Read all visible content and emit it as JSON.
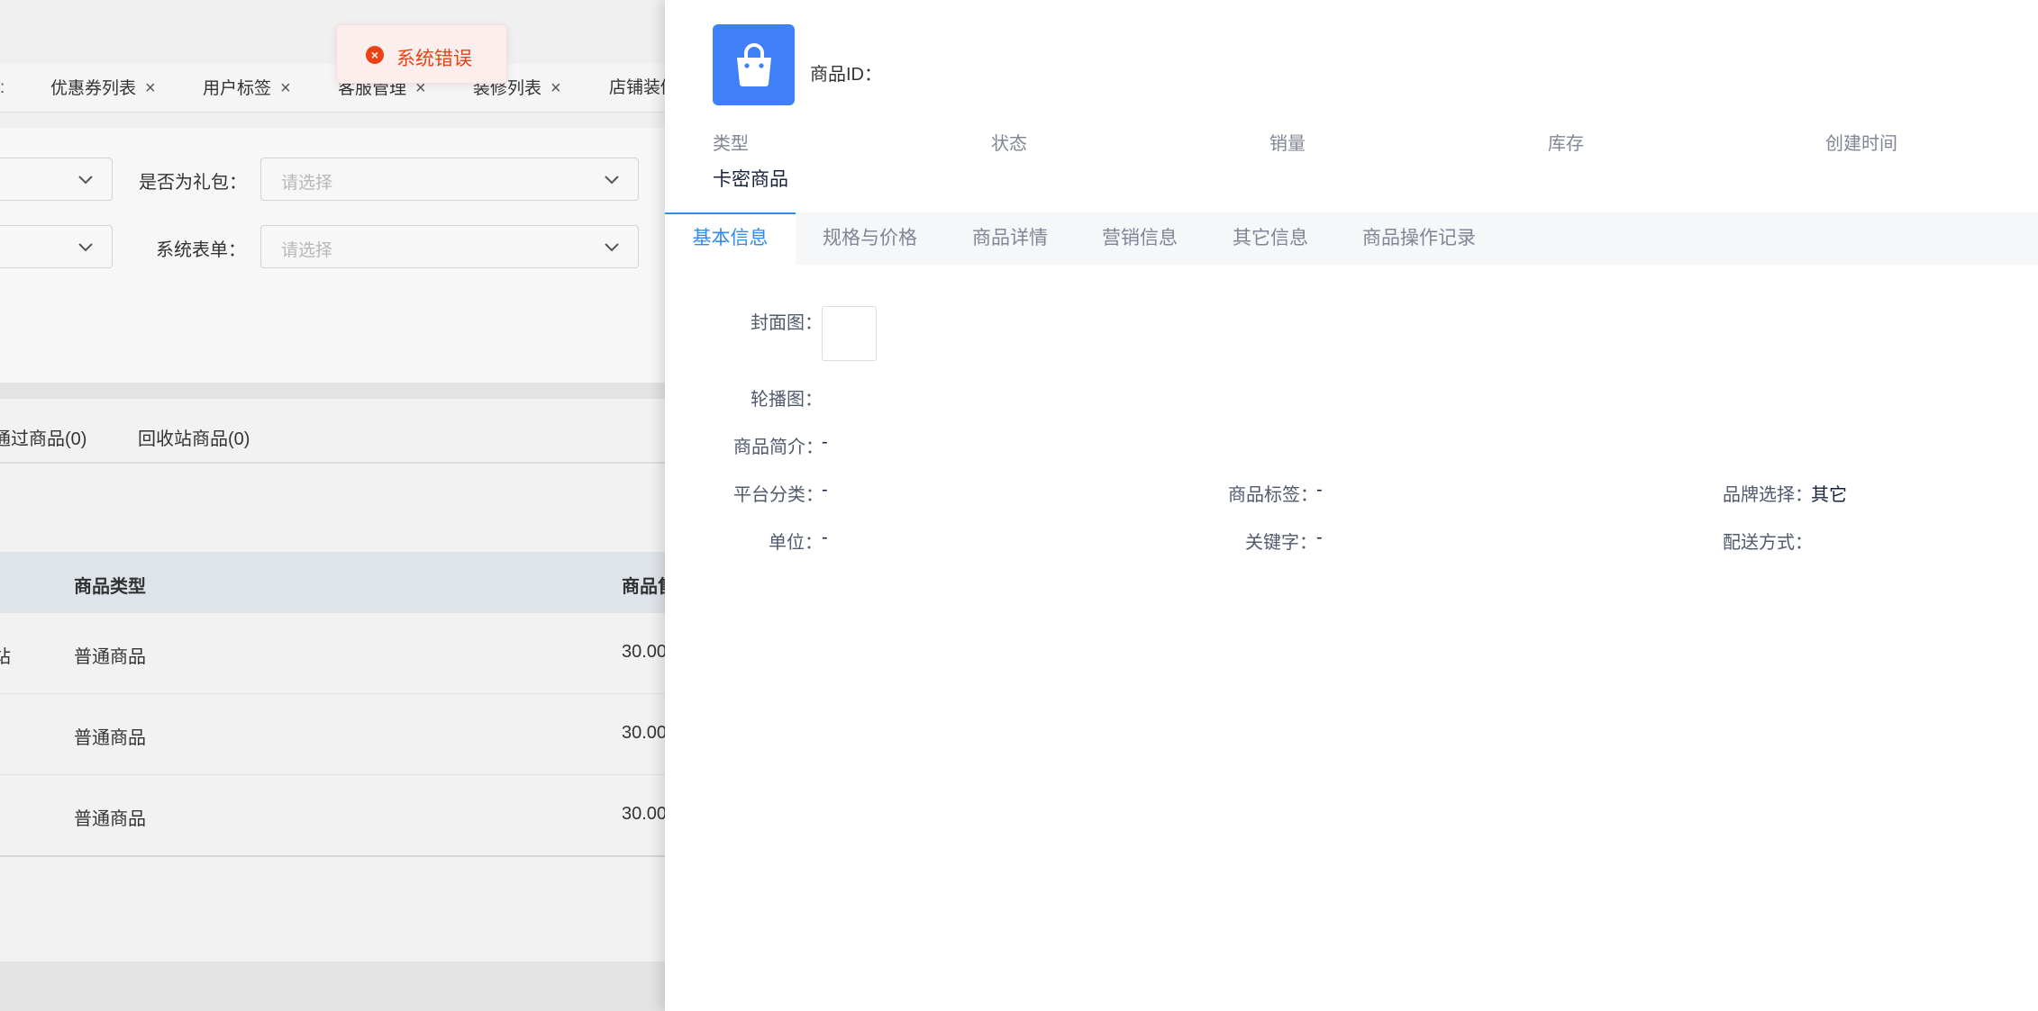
{
  "background": {
    "tabs": [
      {
        "label": "优惠券列表"
      },
      {
        "label": "用户标签"
      },
      {
        "label": "客服管理"
      },
      {
        "label": "装修列表"
      },
      {
        "label": "店铺装修"
      }
    ],
    "filters": {
      "gift_label": "是否为礼包：",
      "gift_placeholder": "请选择",
      "form_label": "系统表单：",
      "form_placeholder": "请选择"
    },
    "status_tabs": {
      "failed": "通过商品(0)",
      "recycle": "回收站商品(0)"
    },
    "table": {
      "col_type": "商品类型",
      "col_price": "商品售价",
      "rows": [
        {
          "prefix": "站",
          "type": "普通商品",
          "price": "30.00"
        },
        {
          "prefix": "",
          "type": "普通商品",
          "price": "30.00"
        },
        {
          "prefix": "",
          "type": "普通商品",
          "price": "30.00"
        }
      ]
    }
  },
  "toast": {
    "message": "系统错误",
    "icon": "error-circle-icon",
    "color": "#ed4014"
  },
  "drawer": {
    "product_id_label": "商品ID：",
    "icon": "shopping-bag-icon",
    "stats": {
      "type_label": "类型",
      "type_value": "卡密商品",
      "status_label": "状态",
      "sales_label": "销量",
      "stock_label": "库存",
      "created_label": "创建时间"
    },
    "tabs": [
      {
        "label": "基本信息",
        "active": true
      },
      {
        "label": "规格与价格",
        "active": false
      },
      {
        "label": "商品详情",
        "active": false
      },
      {
        "label": "营销信息",
        "active": false
      },
      {
        "label": "其它信息",
        "active": false
      },
      {
        "label": "商品操作记录",
        "active": false
      }
    ],
    "basic": {
      "cover_label": "封面图：",
      "carousel_label": "轮播图：",
      "intro_label": "商品简介：",
      "intro_value": "-",
      "category_label": "平台分类：",
      "category_value": "-",
      "tag_label": "商品标签：",
      "tag_value": "-",
      "brand_label": "品牌选择：",
      "brand_value": "其它",
      "unit_label": "单位：",
      "unit_value": "-",
      "keyword_label": "关键字：",
      "keyword_value": "-",
      "delivery_label": "配送方式："
    }
  },
  "colors": {
    "accent": "#2d8cf0",
    "icon_bg": "#3f7ff7"
  }
}
